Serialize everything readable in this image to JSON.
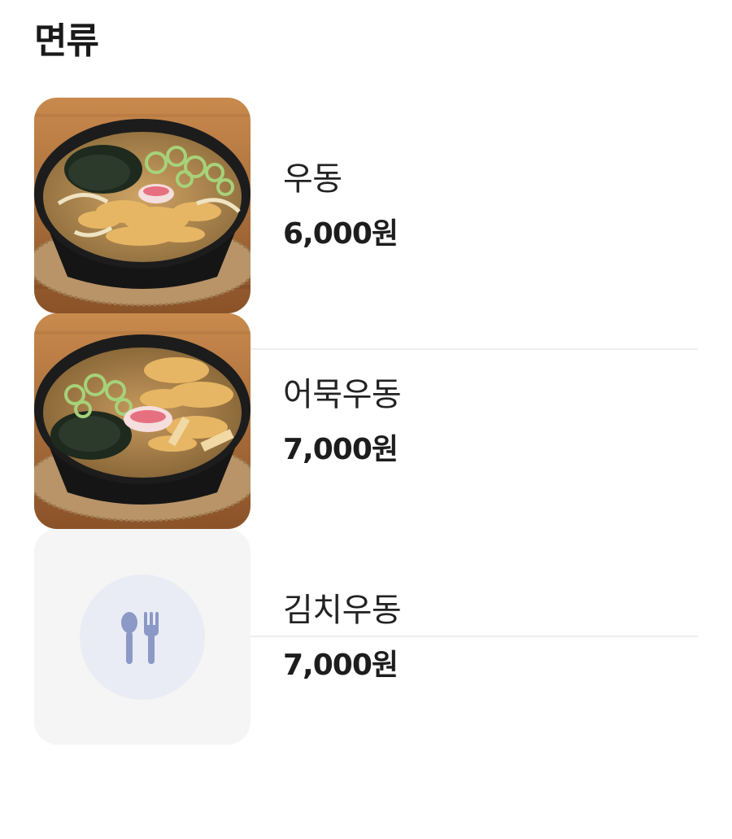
{
  "section": {
    "title": "면류"
  },
  "items": [
    {
      "name": "우동",
      "price": "6,000원"
    },
    {
      "name": "어묵우동",
      "price": "7,000원"
    },
    {
      "name": "김치우동",
      "price": "7,000원"
    }
  ],
  "colors": {
    "divider": "#eeeeee",
    "placeholder_bg": "#f5f5f6",
    "placeholder_circle": "#e9ecf4",
    "placeholder_icon": "#8c99c6"
  },
  "icons": {
    "placeholder": "utensils-icon"
  }
}
